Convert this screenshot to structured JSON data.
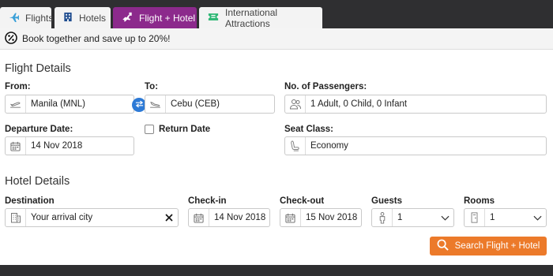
{
  "tabs": [
    {
      "label": "Flights",
      "icon": "plane-icon"
    },
    {
      "label": "Hotels",
      "icon": "building-icon"
    },
    {
      "label": "Flight + Hotel",
      "icon": "plane-building-icon",
      "active": true
    },
    {
      "label": "International Attractions",
      "icon": "ticket-icon"
    }
  ],
  "promo": {
    "text": "Book together and save up to 20%!"
  },
  "flight": {
    "title": "Flight Details",
    "from_label": "From:",
    "from_value": "Manila (MNL)",
    "to_label": "To:",
    "to_value": "Cebu (CEB)",
    "passengers_label": "No. of Passengers:",
    "passengers_value": "1 Adult, 0 Child, 0 Infant",
    "departure_label": "Departure Date:",
    "departure_value": "14 Nov 2018",
    "return_label": "Return Date",
    "return_checked": false,
    "seat_label": "Seat Class:",
    "seat_value": "Economy"
  },
  "hotel": {
    "title": "Hotel Details",
    "destination_label": "Destination",
    "destination_value": "Your arrival city",
    "checkin_label": "Check-in",
    "checkin_value": "14 Nov 2018",
    "checkout_label": "Check-out",
    "checkout_value": "15 Nov 2018",
    "guests_label": "Guests",
    "guests_value": "1",
    "rooms_label": "Rooms",
    "rooms_value": "1"
  },
  "search_button": {
    "label": "Search Flight + Hotel"
  },
  "colors": {
    "accent_tab": "#8c2a8c",
    "search_button": "#ec7a2a",
    "swap_button": "#2d7ad6",
    "flight_tab_icon": "#3aa0d8",
    "attractions_icon": "#2bb673"
  }
}
